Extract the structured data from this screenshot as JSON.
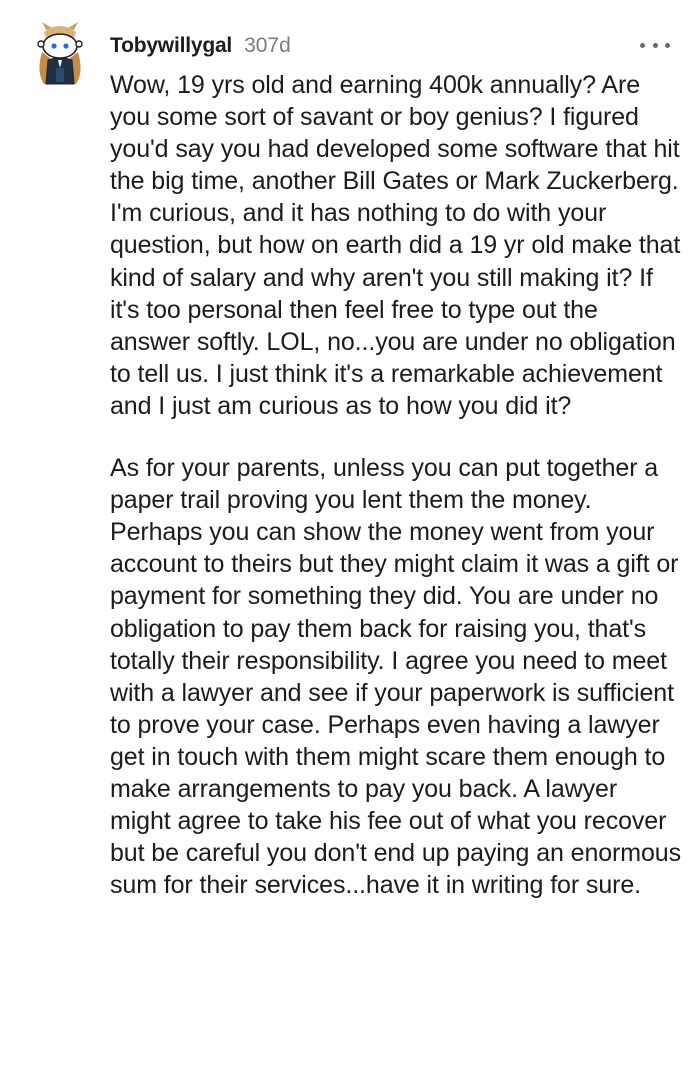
{
  "comment": {
    "username": "Tobywillygal",
    "age": "307d",
    "more_icon": "more-dots-icon",
    "avatar_icon": "snoo-avatar-icon",
    "paragraphs": [
      "Wow, 19 yrs old and earning 400k annually? Are you some sort of savant or boy genius? I figured you'd say you had developed some software that hit the big time, another Bill Gates or Mark Zuckerberg. I'm curious, and it has nothing to do with your question, but how on earth did a 19 yr old make that kind of salary and why aren't you still making it? If it's too personal then feel free to type out the answer softly. LOL, no...you are under no obligation to tell us. I just think it's a remarkable achievement and I just am curious as to how you did it?",
      "As for your parents, unless you can put together a paper trail proving you lent them the money. Perhaps you can show the money went from your account to theirs but they might claim it was a gift or payment for something they did. You are under no obligation to pay them back for raising you, that's totally their responsibility. I agree you need to meet with a lawyer and see if your paperwork is sufficient to prove your case. Perhaps even having a lawyer get in touch with them might scare them enough to make arrangements to pay you back. A lawyer might agree to take his fee out of what you recover but be careful you don't end up paying an enormous sum for their services...have it in writing for sure."
    ]
  }
}
